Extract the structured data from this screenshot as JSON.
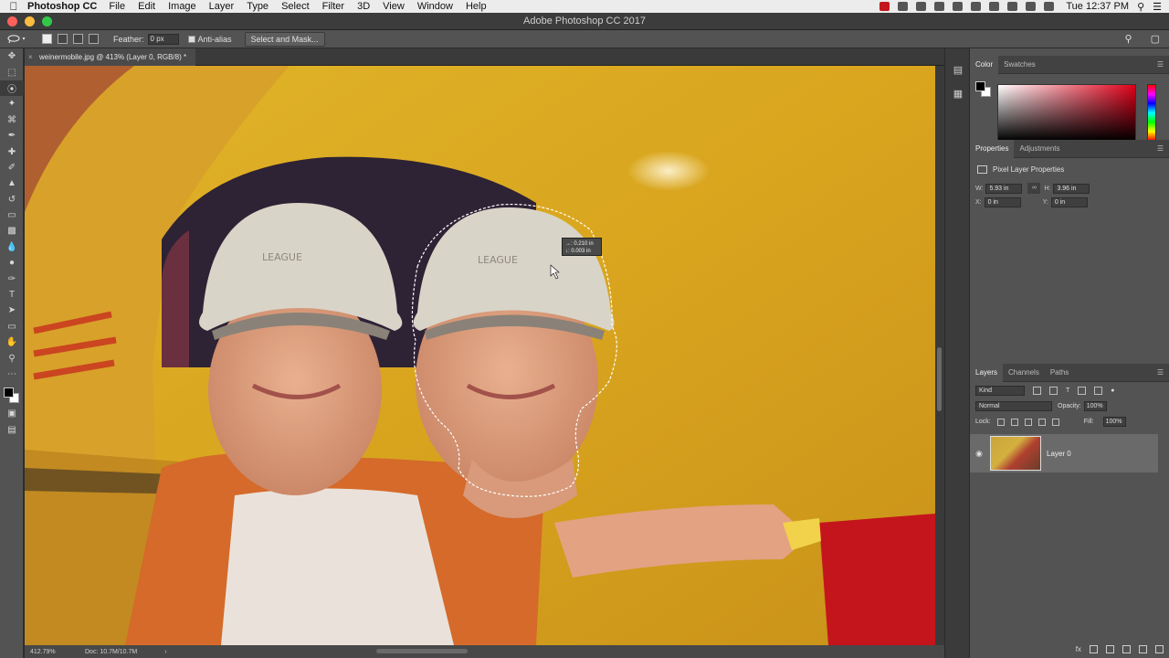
{
  "menubar": {
    "app_name": "Photoshop CC",
    "items": [
      "File",
      "Edit",
      "Image",
      "Layer",
      "Type",
      "Select",
      "Filter",
      "3D",
      "View",
      "Window",
      "Help"
    ],
    "clock": "Tue 12:37 PM"
  },
  "window": {
    "title": "Adobe Photoshop CC 2017"
  },
  "options": {
    "feather_label": "Feather:",
    "feather_value": "0 px",
    "antialias_label": "Anti-alias",
    "select_mask_label": "Select and Mask..."
  },
  "document": {
    "tab_title": "weinermobile.jpg @ 413% (Layer 0, RGB/8) *",
    "measure_w": "→: 0.210 in",
    "measure_h": "↓: 0.003 in"
  },
  "status": {
    "zoom": "412.79%",
    "doc_size": "Doc: 10.7M/10.7M"
  },
  "panels": {
    "color": {
      "tabs": [
        "Color",
        "Swatches"
      ]
    },
    "properties": {
      "tabs": [
        "Properties",
        "Adjustments"
      ],
      "layer_type": "Pixel Layer Properties",
      "w_label": "W:",
      "w_value": "5.93 in",
      "h_label": "H:",
      "h_value": "3.96 in",
      "x_label": "X:",
      "x_value": "0 in",
      "y_label": "Y:",
      "y_value": "0 in"
    },
    "layers": {
      "tabs": [
        "Layers",
        "Channels",
        "Paths"
      ],
      "kind": "Kind",
      "blend_mode": "Normal",
      "opacity_label": "Opacity:",
      "opacity_value": "100%",
      "lock_label": "Lock:",
      "fill_label": "Fill:",
      "fill_value": "100%",
      "layer_name": "Layer 0"
    }
  }
}
